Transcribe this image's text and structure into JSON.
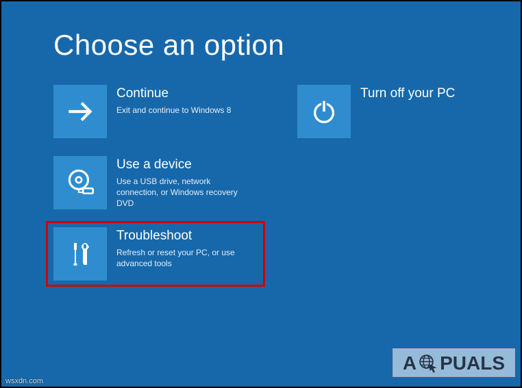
{
  "title": "Choose an option",
  "tiles": {
    "continue": {
      "title": "Continue",
      "desc": "Exit and continue to Windows 8"
    },
    "poweroff": {
      "title": "Turn off your PC",
      "desc": ""
    },
    "device": {
      "title": "Use a device",
      "desc": "Use a USB drive, network connection, or Windows recovery DVD"
    },
    "troubleshoot": {
      "title": "Troubleshoot",
      "desc": "Refresh or reset your PC, or use advanced tools"
    }
  },
  "watermark": {
    "prefix": "A",
    "suffix": "PUALS"
  },
  "origin": "wsxdn.com"
}
